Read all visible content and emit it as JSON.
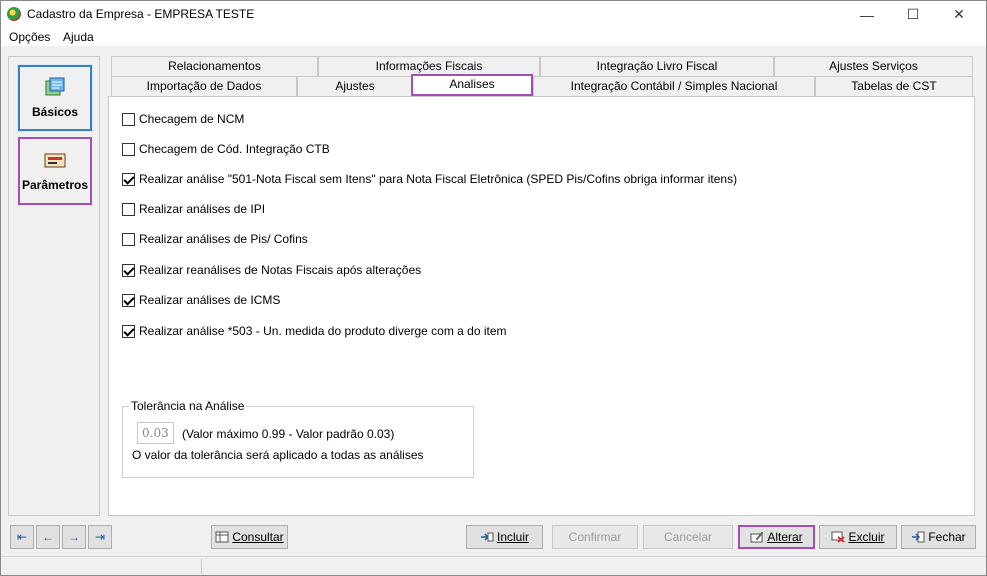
{
  "window": {
    "title": "Cadastro da Empresa - EMPRESA TESTE",
    "controls": {
      "minimize": "—",
      "maximize": "☐",
      "close": "✕"
    }
  },
  "menu": {
    "items": [
      "Opções",
      "Ajuda"
    ]
  },
  "sidebar": {
    "items": [
      {
        "label": "Básicos",
        "icon": "basic-data-icon"
      },
      {
        "label": "Parâmetros",
        "icon": "parameters-icon"
      }
    ]
  },
  "tabs": {
    "row1": [
      "Relacionamentos",
      "Informações Fiscais",
      "Integração Livro Fiscal",
      "Ajustes Serviços"
    ],
    "row2": [
      "Importação de Dados",
      "Ajustes",
      "Analises",
      "Integração Contábil / Simples Nacional",
      "Tabelas de CST"
    ],
    "active": "Analises"
  },
  "options": [
    {
      "label": "Checagem de NCM",
      "checked": false
    },
    {
      "label": "Checagem de Cód. Integração CTB",
      "checked": false
    },
    {
      "label": "Realizar análise \"501-Nota Fiscal sem Itens\" para Nota Fiscal Eletrônica (SPED Pis/Cofins obriga informar itens)",
      "checked": true
    },
    {
      "label": "Realizar análises de IPI",
      "checked": false
    },
    {
      "label": "Realizar análises de Pis/ Cofins",
      "checked": false
    },
    {
      "label": "Realizar reanálises de Notas Fiscais após alterações",
      "checked": true
    },
    {
      "label": "Realizar análises de ICMS",
      "checked": true
    },
    {
      "label": "Realizar análise *503 - Un. medida do produto diverge com a do item",
      "checked": true
    }
  ],
  "tolerance": {
    "legend": "Tolerância na Análise",
    "value": "0.03",
    "hint": "(Valor máximo 0.99 - Valor padrão 0.03)",
    "note": "O valor da tolerância será aplicado a todas as análises"
  },
  "navigation": {
    "first": "⇤",
    "prev": "←",
    "next": "→",
    "last": "⇥"
  },
  "buttons": {
    "consultar": "Consultar",
    "incluir": "Incluir",
    "confirmar": "Confirmar",
    "cancelar": "Cancelar",
    "alterar": "Alterar",
    "excluir": "Excluir",
    "fechar": "Fechar"
  },
  "colors": {
    "highlight": "#a24fb5",
    "focus": "#3a7fc4"
  }
}
